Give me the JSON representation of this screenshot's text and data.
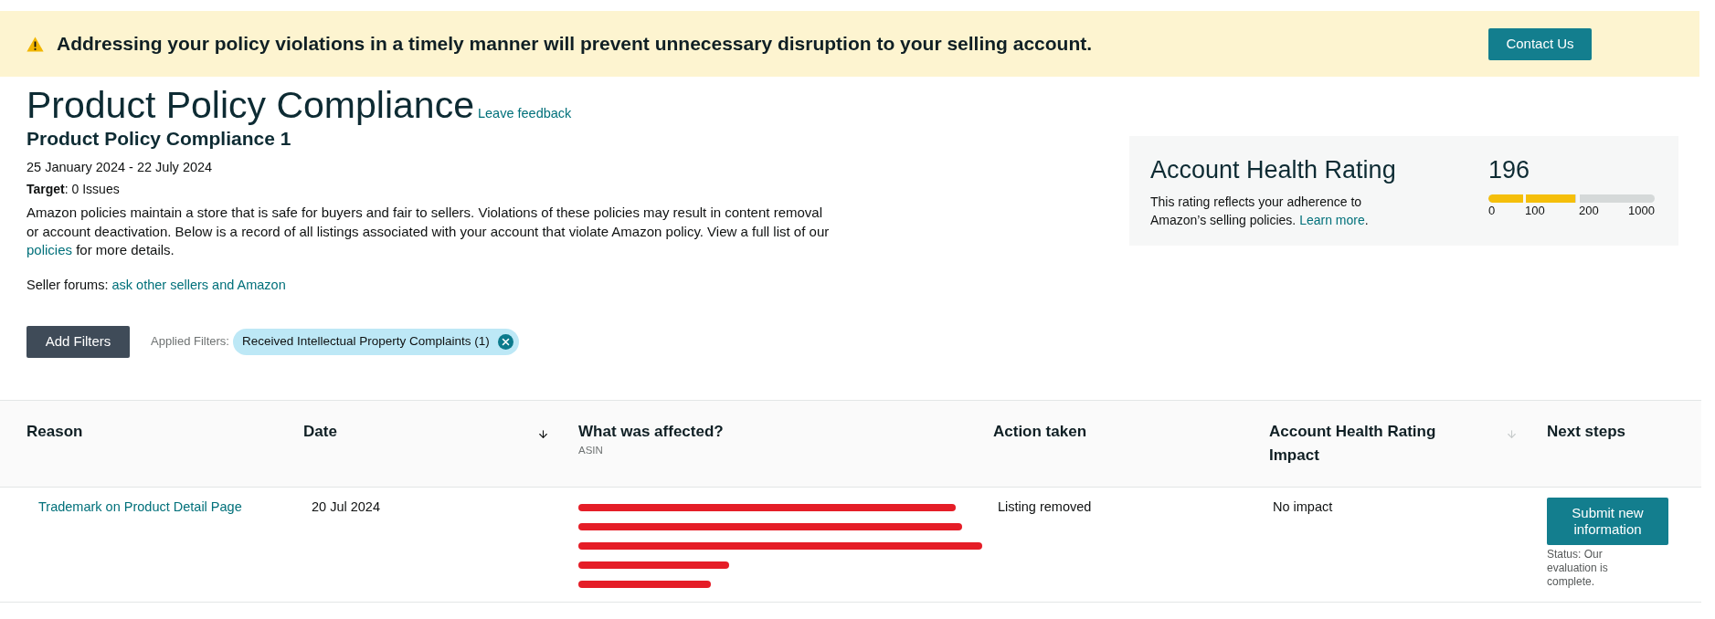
{
  "banner": {
    "message": "Addressing your policy violations in a timely manner will prevent unnecessary disruption to your selling account.",
    "button": "Contact Us"
  },
  "header": {
    "title": "Product Policy Compliance",
    "feedback_link": "Leave feedback",
    "subtitle": "Product Policy Compliance 1",
    "date_range": "25 January 2024 - 22 July 2024",
    "target": "**Target**: 0 Issues",
    "description": [
      {
        "kind": "text",
        "text": "Amazon policies maintain a store that is safe for buyers and fair to sellers. Violations of these policies may result in content removal or account deactivation. Below is a record of all listings associated with your account that violate Amazon policy. View a full list of our "
      },
      {
        "kind": "link",
        "text": "policies"
      },
      {
        "kind": "text",
        "text": " for more details."
      }
    ],
    "forums": [
      {
        "kind": "text",
        "text": "Seller forums: "
      },
      {
        "kind": "link",
        "text": "ask other sellers and Amazon"
      }
    ]
  },
  "health": {
    "title": "Account Health Rating",
    "description": [
      {
        "kind": "text",
        "text": "This rating reflects your adherence to Amazon’s selling policies. "
      },
      {
        "kind": "link",
        "text": "Learn more"
      },
      {
        "kind": "text",
        "text": "."
      }
    ],
    "score": "196",
    "level": 0.52,
    "ticks": [
      "0",
      "100",
      "200",
      "1000"
    ]
  },
  "filters": {
    "button": "Add Filters",
    "label": "Applied Filters:",
    "chips": [
      {
        "text": "Received Intellectual Property Complaints (1)"
      }
    ]
  },
  "table": {
    "columns": [
      {
        "title": "Reason"
      },
      {
        "title": "Date",
        "sortable": true,
        "sort_active": true
      },
      {
        "title": "What was affected?",
        "subtitle": "ASIN"
      },
      {
        "title": "Action taken"
      },
      {
        "title": "Account Health Rating Impact",
        "sortable": true,
        "sort_active": false
      },
      {
        "title": "Next steps"
      }
    ],
    "rows": [
      {
        "reason": "Trademark on Product Detail Page",
        "date": "20 Jul 2024",
        "affected_redacted": true,
        "action": "Listing removed",
        "impact": "No impact",
        "next_step_button": "Submit new information",
        "status": "Status: Our evaluation is complete."
      }
    ]
  }
}
